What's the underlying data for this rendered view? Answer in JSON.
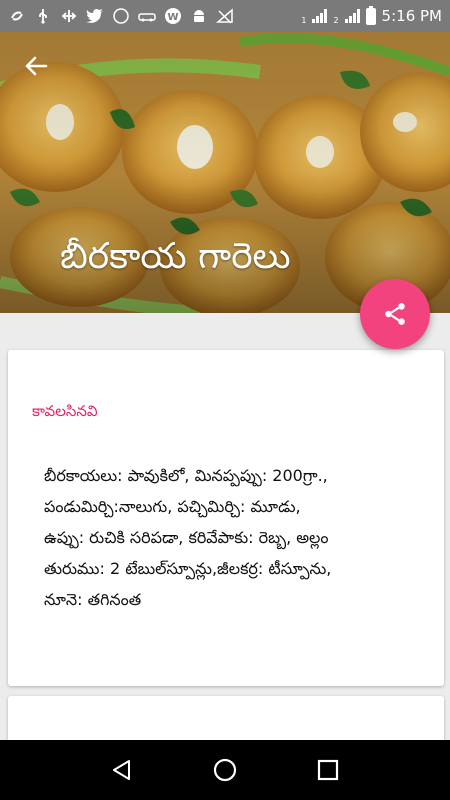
{
  "status_bar": {
    "time": "5:16 PM",
    "sim1_label": "1",
    "sim2_label": "2",
    "notification_icons": [
      "sync-icon",
      "usb-icon",
      "cross-arrows-icon",
      "twitter-icon",
      "compass-icon",
      "car-icon",
      "w-app-icon",
      "android-icon",
      "no-signal-icon"
    ]
  },
  "header": {
    "title": "బీరకాయ గారెలు",
    "back_icon": "arrow-left-icon",
    "image_description_icon": "food-photo"
  },
  "fab": {
    "icon": "share-icon",
    "color": "#f3437e"
  },
  "card": {
    "section_title": "కావలసినవి",
    "ingredients_lines": [
      "బీరకాయలు: పావుకిలో, మినప్పప్పు: 200గ్రా.,",
      "పండుమిర్చి:నాలుగు, పచ్చిమిర్చి: మూడు,",
      "ఉప్పు: రుచికి సరిపడా, కరివేపాకు: రెబ్బ, అల్లం",
      "తురుము: 2 టేబుల్‌స్పూన్లు,జీలకర్ర: టీస్పూను,",
      "నూనె: తగినంత"
    ],
    "accent_color": "#e0266b"
  },
  "nav_bar": {
    "back": "nav-back-icon",
    "home": "nav-home-icon",
    "recents": "nav-recents-icon"
  }
}
